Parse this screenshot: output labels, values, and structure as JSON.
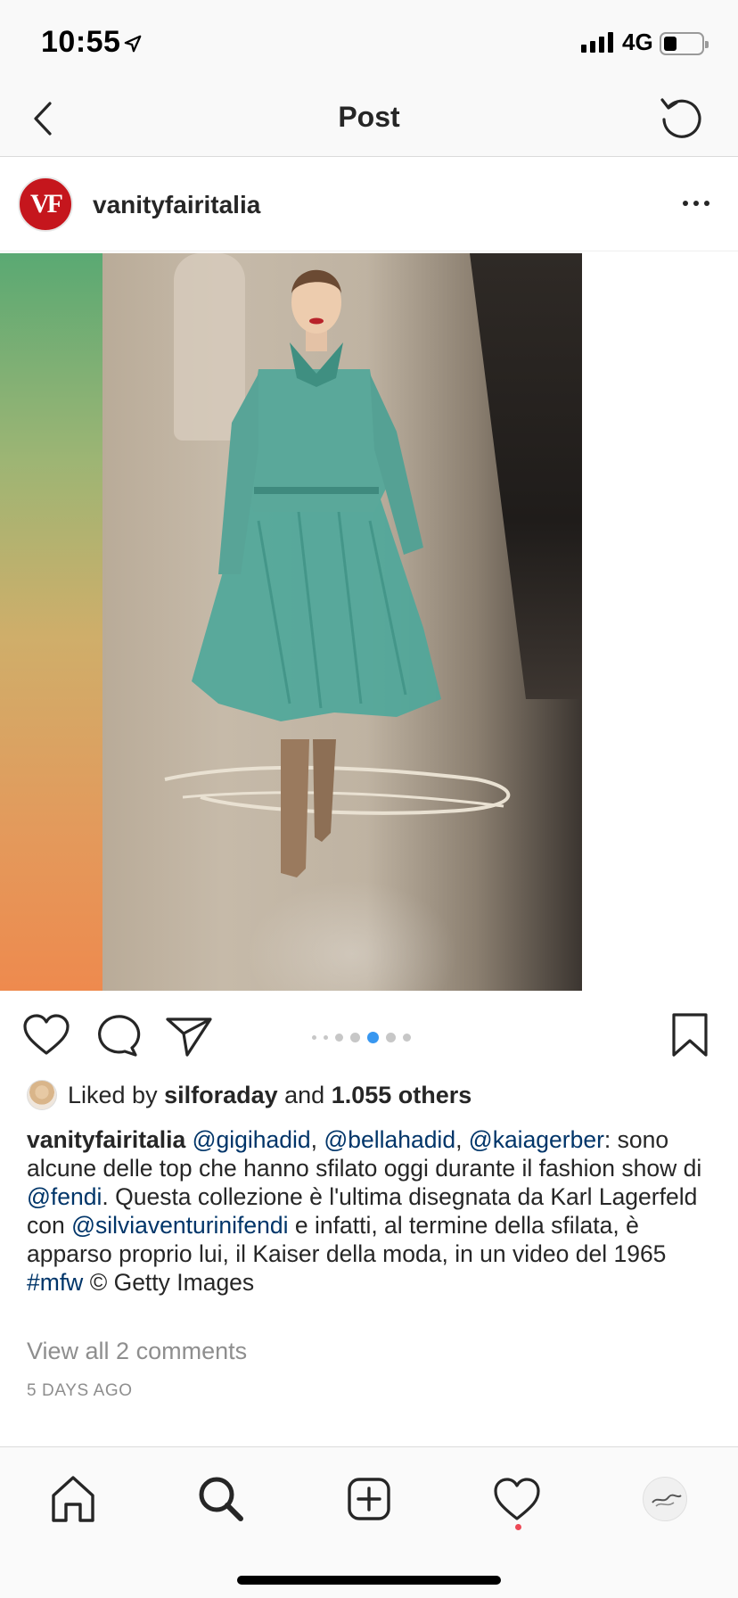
{
  "status_bar": {
    "time": "10:55",
    "network": "4G",
    "battery_level_percent": 35
  },
  "header": {
    "title": "Post",
    "back_icon": "chevron-left-icon",
    "refresh_icon": "refresh-icon"
  },
  "post": {
    "username": "vanityfairitalia",
    "avatar_text": "VF",
    "more_icon": "more-horizontal-icon",
    "carousel": {
      "total": 7,
      "current_index": 4
    },
    "likes": {
      "prefix": "Liked by ",
      "user": "silforaday",
      "middle": " and ",
      "count": "1.055 others"
    },
    "caption": {
      "user": "vanityfairitalia",
      "m1": "@gigihadid",
      "s1": ", ",
      "m2": "@bellahadid",
      "s2": ", ",
      "m3": "@kaiagerber",
      "t1": ": sono alcune delle top che hanno sfilato oggi durante il fashion show di ",
      "m4": "@fendi",
      "t2": ". Questa collezione è l'ultima disegnata da Karl Lagerfeld con ",
      "m5": "@silviaventurinifendi",
      "t3": " e infatti, al termine della sfilata, è apparso proprio lui, il Kaiser della moda, in un video del 1965 ",
      "m6": "#mfw",
      "t4": " © Getty Images"
    },
    "view_comments": "View all 2 comments",
    "timestamp": "5 DAYS AGO"
  },
  "actions": {
    "like_icon": "heart-icon",
    "comment_icon": "comment-icon",
    "share_icon": "paper-plane-icon",
    "save_icon": "bookmark-icon"
  },
  "tab_bar": {
    "tabs": [
      "home-icon",
      "search-icon",
      "add-post-icon",
      "heart-activity-icon",
      "profile-icon"
    ],
    "activity_has_notification": true
  },
  "colors": {
    "mention": "#003569",
    "muted": "#8e8e8e",
    "notification": "#ed4956",
    "carousel_active": "#3897f0"
  }
}
